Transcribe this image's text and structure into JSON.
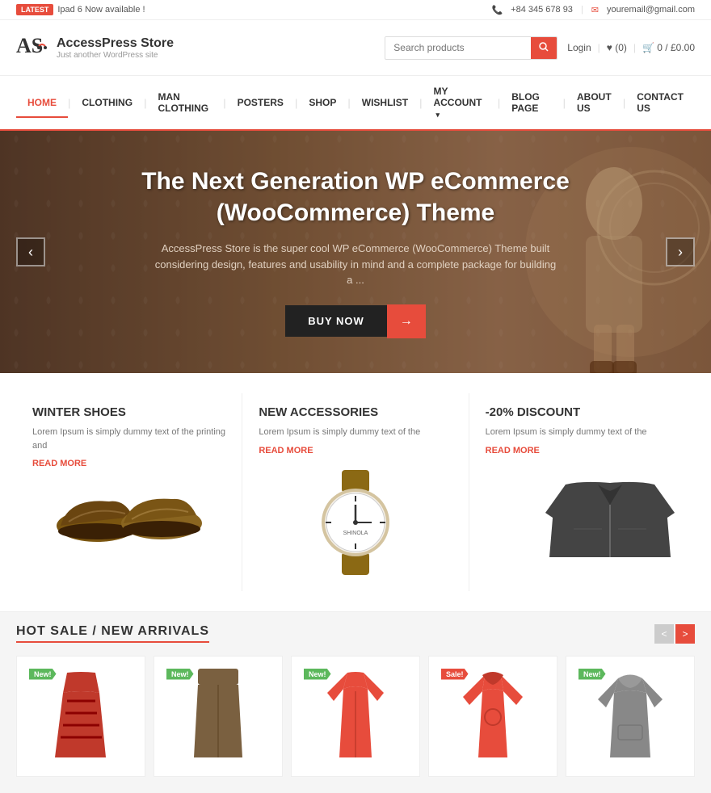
{
  "topbar": {
    "badge": "LATEST",
    "announcement": "Ipad 6 Now available !",
    "phone": "+84 345 678 93",
    "email": "youremail@gmail.com"
  },
  "header": {
    "logo_icon": "AS",
    "logo_name": "AccessPress Store",
    "logo_tagline": "Just another WordPress site",
    "search_placeholder": "Search products",
    "login_label": "Login",
    "wishlist_label": "♥ (0)",
    "cart_label": "🛒 0 / £0.00"
  },
  "nav": {
    "items": [
      {
        "label": "HOME",
        "active": true,
        "has_dropdown": false
      },
      {
        "label": "CLOTHING",
        "active": false,
        "has_dropdown": false
      },
      {
        "label": "MAN CLOTHING",
        "active": false,
        "has_dropdown": false
      },
      {
        "label": "POSTERS",
        "active": false,
        "has_dropdown": false
      },
      {
        "label": "SHOP",
        "active": false,
        "has_dropdown": false
      },
      {
        "label": "WISHLIST",
        "active": false,
        "has_dropdown": false
      },
      {
        "label": "MY ACCOUNT",
        "active": false,
        "has_dropdown": true
      },
      {
        "label": "BLOG PAGE",
        "active": false,
        "has_dropdown": false
      },
      {
        "label": "ABOUT US",
        "active": false,
        "has_dropdown": false
      },
      {
        "label": "CONTACT US",
        "active": false,
        "has_dropdown": false
      }
    ]
  },
  "hero": {
    "title": "The Next Generation WP eCommerce (WooCommerce) Theme",
    "description": "AccessPress Store is the super cool WP eCommerce (WooCommerce) Theme  built considering design, features and usability in mind and a complete package for building a ...",
    "btn_buy": "BUY NOW",
    "btn_arrow": "→"
  },
  "features": [
    {
      "title": "WINTER SHOES",
      "description": "Lorem Ipsum is simply dummy text of the printing and",
      "read_more": "READ MORE"
    },
    {
      "title": "NEW ACCESSORIES",
      "description": "Lorem Ipsum is simply dummy text of the",
      "read_more": "READ MORE"
    },
    {
      "title": "-20% DISCOUNT",
      "description": "Lorem Ipsum is simply dummy text of the",
      "read_more": "READ MORE"
    }
  ],
  "hot_sale": {
    "title": "HOT SALE / NEW ARRIVALS",
    "prev_label": "<",
    "next_label": ">"
  },
  "products": [
    {
      "badge": "New!",
      "badge_type": "new",
      "color": "dress"
    },
    {
      "badge": "New!",
      "badge_type": "new",
      "color": "pants"
    },
    {
      "badge": "New!",
      "badge_type": "new",
      "color": "jacket-red"
    },
    {
      "badge": "Sale!",
      "badge_type": "sale",
      "color": "jacket-red"
    },
    {
      "badge": "New!",
      "badge_type": "new",
      "color": "hoodie"
    }
  ]
}
